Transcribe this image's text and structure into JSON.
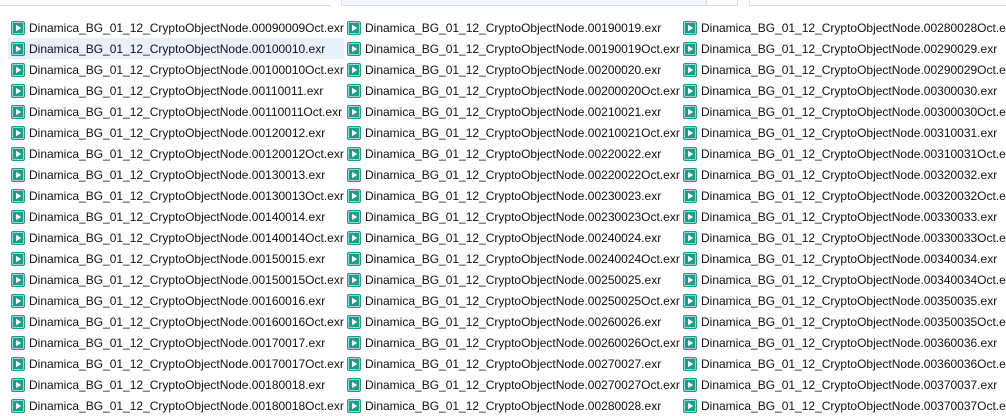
{
  "columns": [
    {
      "items": [
        "Dinamica_BG_01_12_CryptoObjectNode.00090009Oct.exr",
        "Dinamica_BG_01_12_CryptoObjectNode.00100010.exr",
        "Dinamica_BG_01_12_CryptoObjectNode.00100010Oct.exr",
        "Dinamica_BG_01_12_CryptoObjectNode.00110011.exr",
        "Dinamica_BG_01_12_CryptoObjectNode.00110011Oct.exr",
        "Dinamica_BG_01_12_CryptoObjectNode.00120012.exr",
        "Dinamica_BG_01_12_CryptoObjectNode.00120012Oct.exr",
        "Dinamica_BG_01_12_CryptoObjectNode.00130013.exr",
        "Dinamica_BG_01_12_CryptoObjectNode.00130013Oct.exr",
        "Dinamica_BG_01_12_CryptoObjectNode.00140014.exr",
        "Dinamica_BG_01_12_CryptoObjectNode.00140014Oct.exr",
        "Dinamica_BG_01_12_CryptoObjectNode.00150015.exr",
        "Dinamica_BG_01_12_CryptoObjectNode.00150015Oct.exr",
        "Dinamica_BG_01_12_CryptoObjectNode.00160016.exr",
        "Dinamica_BG_01_12_CryptoObjectNode.00160016Oct.exr",
        "Dinamica_BG_01_12_CryptoObjectNode.00170017.exr",
        "Dinamica_BG_01_12_CryptoObjectNode.00170017Oct.exr",
        "Dinamica_BG_01_12_CryptoObjectNode.00180018.exr",
        "Dinamica_BG_01_12_CryptoObjectNode.00180018Oct.exr"
      ]
    },
    {
      "items": [
        "Dinamica_BG_01_12_CryptoObjectNode.00190019.exr",
        "Dinamica_BG_01_12_CryptoObjectNode.00190019Oct.exr",
        "Dinamica_BG_01_12_CryptoObjectNode.00200020.exr",
        "Dinamica_BG_01_12_CryptoObjectNode.00200020Oct.exr",
        "Dinamica_BG_01_12_CryptoObjectNode.00210021.exr",
        "Dinamica_BG_01_12_CryptoObjectNode.00210021Oct.exr",
        "Dinamica_BG_01_12_CryptoObjectNode.00220022.exr",
        "Dinamica_BG_01_12_CryptoObjectNode.00220022Oct.exr",
        "Dinamica_BG_01_12_CryptoObjectNode.00230023.exr",
        "Dinamica_BG_01_12_CryptoObjectNode.00230023Oct.exr",
        "Dinamica_BG_01_12_CryptoObjectNode.00240024.exr",
        "Dinamica_BG_01_12_CryptoObjectNode.00240024Oct.exr",
        "Dinamica_BG_01_12_CryptoObjectNode.00250025.exr",
        "Dinamica_BG_01_12_CryptoObjectNode.00250025Oct.exr",
        "Dinamica_BG_01_12_CryptoObjectNode.00260026.exr",
        "Dinamica_BG_01_12_CryptoObjectNode.00260026Oct.exr",
        "Dinamica_BG_01_12_CryptoObjectNode.00270027.exr",
        "Dinamica_BG_01_12_CryptoObjectNode.00270027Oct.exr",
        "Dinamica_BG_01_12_CryptoObjectNode.00280028.exr"
      ]
    },
    {
      "items": [
        "Dinamica_BG_01_12_CryptoObjectNode.00280028Oct.exr",
        "Dinamica_BG_01_12_CryptoObjectNode.00290029.exr",
        "Dinamica_BG_01_12_CryptoObjectNode.00290029Oct.exr",
        "Dinamica_BG_01_12_CryptoObjectNode.00300030.exr",
        "Dinamica_BG_01_12_CryptoObjectNode.00300030Oct.exr",
        "Dinamica_BG_01_12_CryptoObjectNode.00310031.exr",
        "Dinamica_BG_01_12_CryptoObjectNode.00310031Oct.exr",
        "Dinamica_BG_01_12_CryptoObjectNode.00320032.exr",
        "Dinamica_BG_01_12_CryptoObjectNode.00320032Oct.exr",
        "Dinamica_BG_01_12_CryptoObjectNode.00330033.exr",
        "Dinamica_BG_01_12_CryptoObjectNode.00330033Oct.exr",
        "Dinamica_BG_01_12_CryptoObjectNode.00340034.exr",
        "Dinamica_BG_01_12_CryptoObjectNode.00340034Oct.exr",
        "Dinamica_BG_01_12_CryptoObjectNode.00350035.exr",
        "Dinamica_BG_01_12_CryptoObjectNode.00350035Oct.exr",
        "Dinamica_BG_01_12_CryptoObjectNode.00360036.exr",
        "Dinamica_BG_01_12_CryptoObjectNode.00360036Oct.exr",
        "Dinamica_BG_01_12_CryptoObjectNode.00370037.exr",
        "Dinamica_BG_01_12_CryptoObjectNode.00370037Oct.exr"
      ]
    }
  ],
  "selected_item": "Dinamica_BG_01_12_CryptoObjectNode.00100010.exr",
  "file_icon": "exr-media-file-icon",
  "colors": {
    "icon_bg": "#1e9c8c",
    "icon_play": "#ffffff",
    "selection": "#e8f1fb"
  }
}
